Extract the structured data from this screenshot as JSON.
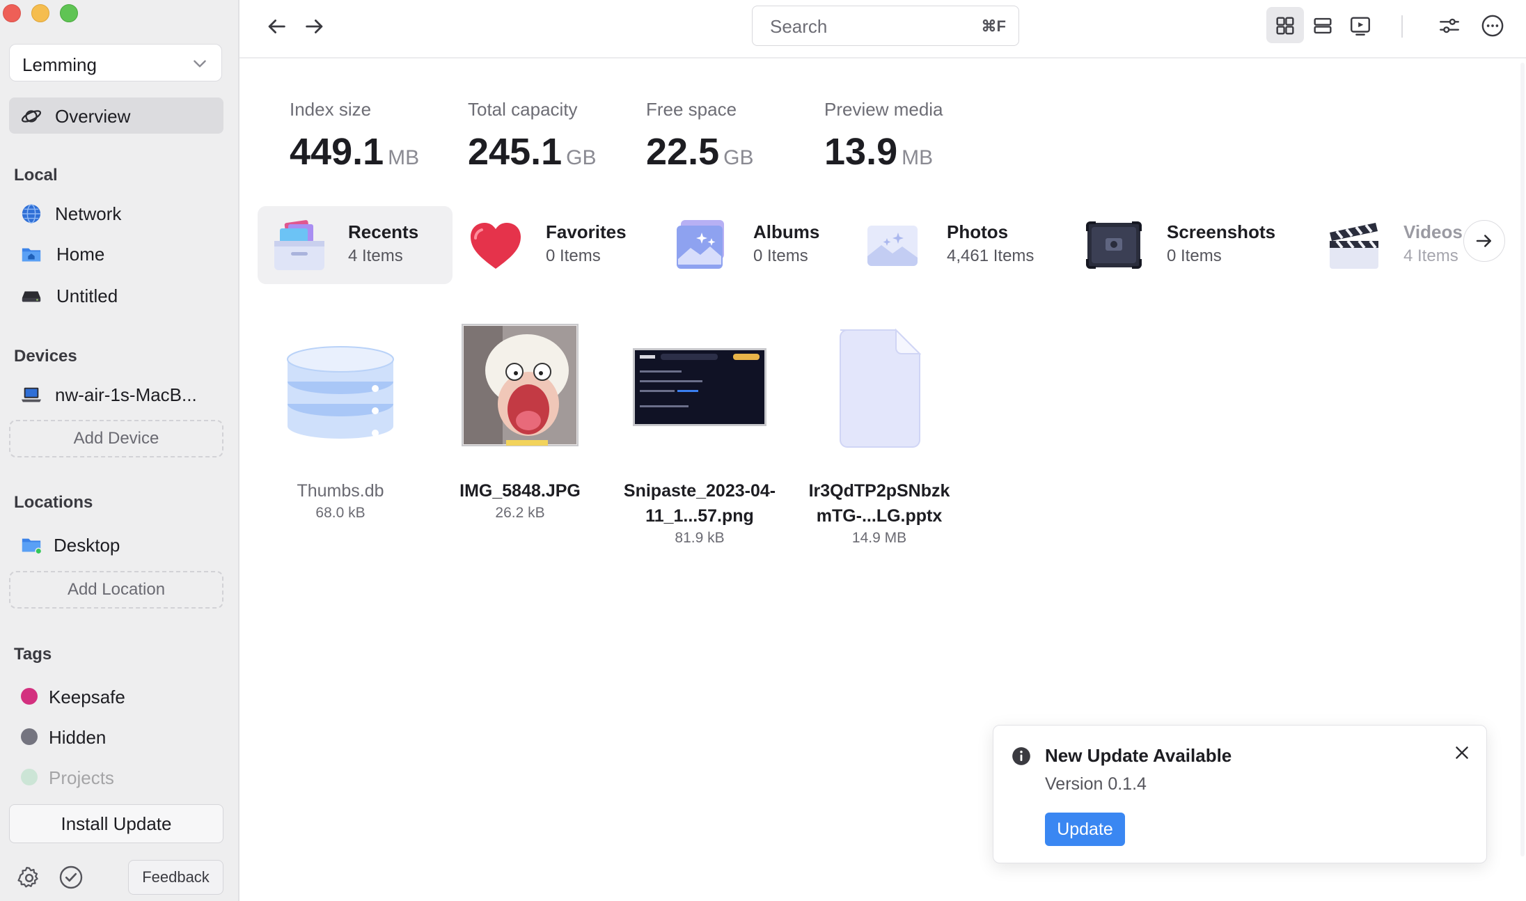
{
  "sidebar": {
    "library_name": "Lemming",
    "overview_label": "Overview",
    "sections": {
      "local": "Local",
      "devices": "Devices",
      "locations": "Locations",
      "tags": "Tags"
    },
    "local_items": [
      {
        "label": "Network",
        "icon": "globe-icon"
      },
      {
        "label": "Home",
        "icon": "home-folder-icon"
      },
      {
        "label": "Untitled",
        "icon": "drive-icon"
      }
    ],
    "device_items": [
      {
        "label": "nw-air-1s-MacB...",
        "icon": "laptop-icon"
      }
    ],
    "add_device_label": "Add Device",
    "location_items": [
      {
        "label": "Desktop",
        "icon": "folder-icon"
      }
    ],
    "add_location_label": "Add Location",
    "tags": [
      {
        "label": "Keepsafe",
        "color": "#d3307f"
      },
      {
        "label": "Hidden",
        "color": "#74747f"
      },
      {
        "label": "Projects",
        "color": "#bfe6cf"
      }
    ],
    "install_update_label": "Install Update",
    "feedback_label": "Feedback"
  },
  "topbar": {
    "search_placeholder": "Search",
    "search_shortcut": "⌘F"
  },
  "stats": [
    {
      "label": "Index size",
      "value": "449.1",
      "unit": "MB"
    },
    {
      "label": "Total capacity",
      "value": "245.1",
      "unit": "GB"
    },
    {
      "label": "Free space",
      "value": "22.5",
      "unit": "GB"
    },
    {
      "label": "Preview media",
      "value": "13.9",
      "unit": "MB"
    }
  ],
  "categories": [
    {
      "name": "Recents",
      "count": "4 Items",
      "icon": "recents-tray-icon"
    },
    {
      "name": "Favorites",
      "count": "0 Items",
      "icon": "heart-icon"
    },
    {
      "name": "Albums",
      "count": "0 Items",
      "icon": "albums-icon"
    },
    {
      "name": "Photos",
      "count": "4,461 Items",
      "icon": "photos-icon"
    },
    {
      "name": "Screenshots",
      "count": "0 Items",
      "icon": "screenshot-icon"
    },
    {
      "name": "Videos",
      "count": "4 Items",
      "icon": "clapperboard-icon"
    }
  ],
  "files": [
    {
      "name": "Thumbs.db",
      "size": "68.0 kB",
      "kind": "database"
    },
    {
      "name": "IMG_5848.JPG",
      "size": "26.2 kB",
      "kind": "image"
    },
    {
      "name": "Snipaste_2023-04-11_1...57.png",
      "size": "81.9 kB",
      "kind": "screenshot"
    },
    {
      "name": "Ir3QdTP2pSNbzkmTG-...LG.pptx",
      "size": "14.9 MB",
      "kind": "document"
    }
  ],
  "toast": {
    "title": "New Update Available",
    "subtitle": "Version 0.1.4",
    "button": "Update"
  },
  "colors": {
    "accent": "#3a87f2",
    "sidebar_bg": "#eeeeef"
  }
}
